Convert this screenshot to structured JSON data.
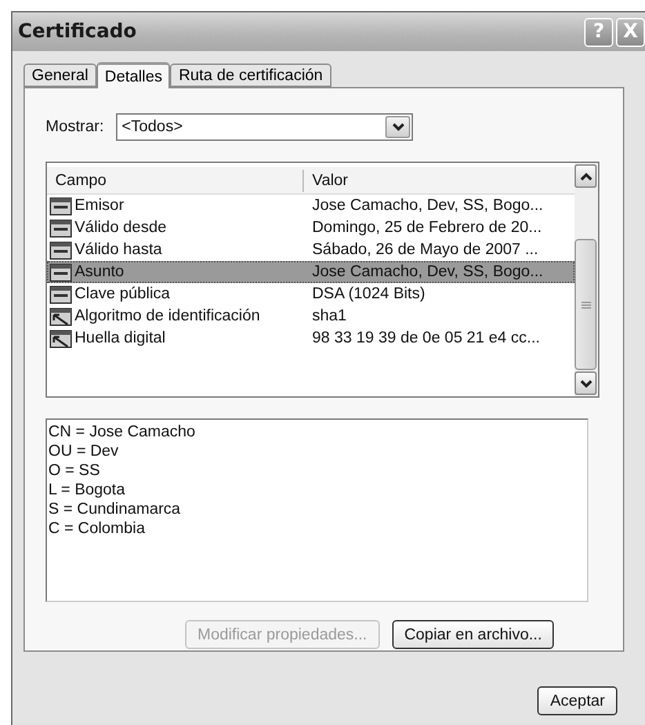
{
  "window": {
    "title": "Certificado",
    "title_buttons": [
      "?",
      "X"
    ]
  },
  "tabs": [
    {
      "label": "General",
      "selected": false
    },
    {
      "label": "Detalles",
      "selected": true
    },
    {
      "label": "Ruta de certificación",
      "selected": false
    }
  ],
  "show": {
    "label": "Mostrar:",
    "value": "<Todos>"
  },
  "table": {
    "columns": [
      "Campo",
      "Valor"
    ],
    "rows": [
      {
        "kind": "field",
        "field": "Emisor",
        "value": "Jose Camacho, Dev, SS, Bogo...",
        "selected": false
      },
      {
        "kind": "field",
        "field": "Válido desde",
        "value": "Domingo, 25 de Febrero de 20...",
        "selected": false
      },
      {
        "kind": "field",
        "field": "Válido hasta",
        "value": "Sábado, 26 de Mayo de 2007 ...",
        "selected": false
      },
      {
        "kind": "field",
        "field": "Asunto",
        "value": "Jose Camacho, Dev, SS, Bogo...",
        "selected": true
      },
      {
        "kind": "field",
        "field": "Clave pública",
        "value": "DSA (1024 Bits)",
        "selected": false
      },
      {
        "kind": "property",
        "field": "Algoritmo de identificación",
        "value": "sha1",
        "selected": false
      },
      {
        "kind": "property",
        "field": "Huella digital",
        "value": "98 33 19 39 de 0e 05 21 e4 cc...",
        "selected": false
      }
    ]
  },
  "details": [
    "CN = Jose Camacho",
    "OU = Dev",
    "O = SS",
    "L = Bogota",
    "S = Cundinamarca",
    "C = Colombia"
  ],
  "buttons": [
    {
      "label": "Modificar propiedades...",
      "disabled": true
    },
    {
      "label": "Copiar en archivo...",
      "disabled": false
    }
  ],
  "footer_buttons": [
    "Aceptar"
  ]
}
